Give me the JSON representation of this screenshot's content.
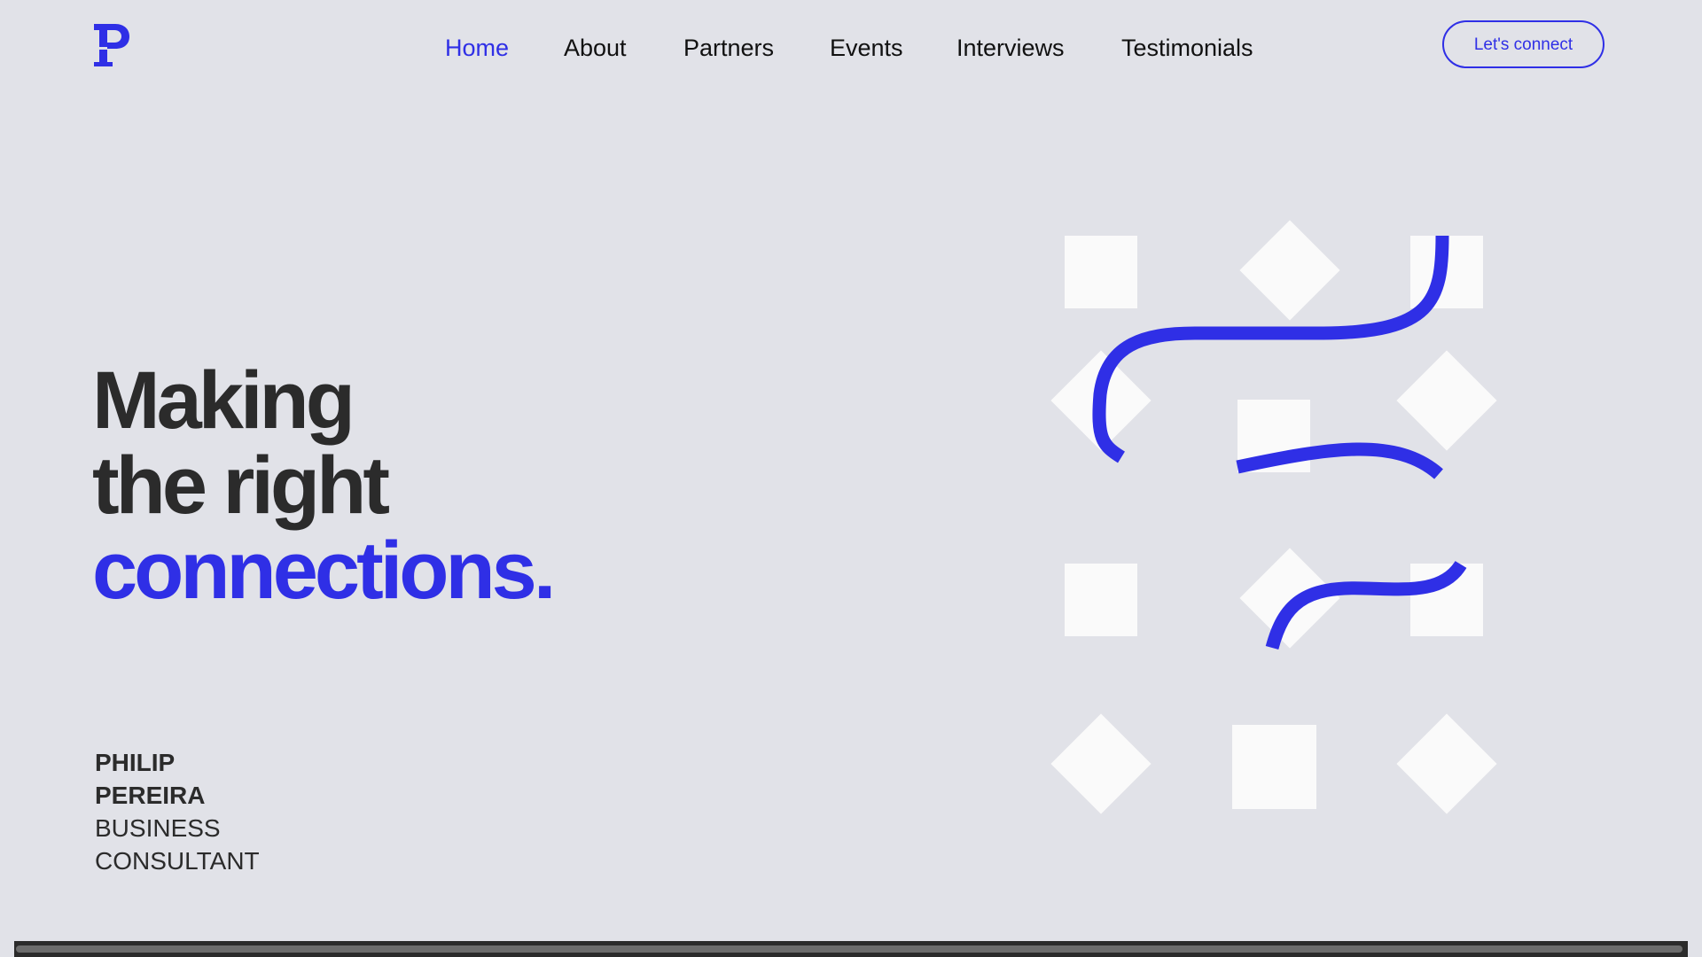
{
  "nav": {
    "items": [
      {
        "label": "Home",
        "active": true
      },
      {
        "label": "About",
        "active": false
      },
      {
        "label": "Partners",
        "active": false
      },
      {
        "label": "Events",
        "active": false
      },
      {
        "label": "Interviews",
        "active": false
      },
      {
        "label": "Testimonials",
        "active": false
      }
    ],
    "cta_label": "Let's connect"
  },
  "logo": {
    "icon": "p-monogram-icon"
  },
  "hero": {
    "line1": "Making",
    "line2": "the right",
    "line3": "connections."
  },
  "person": {
    "first_name": "PHILIP",
    "last_name": "PEREIRA",
    "role_line1": "BUSINESS",
    "role_line2": "CONSULTANT"
  },
  "colors": {
    "accent": "#2f2fe6",
    "background": "#e1e2e8",
    "text": "#2b2b2b",
    "shape_fill": "#fafafa"
  }
}
